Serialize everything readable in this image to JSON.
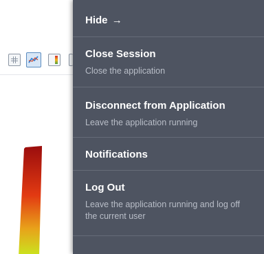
{
  "menu": {
    "hide": {
      "label": "Hide",
      "arrow": "→"
    },
    "items": [
      {
        "title": "Close Session",
        "description": "Close the application"
      },
      {
        "title": "Disconnect from Application",
        "description": "Leave the application running"
      },
      {
        "title": "Notifications",
        "description": ""
      },
      {
        "title": "Log Out",
        "description": "Leave the application running and log off the current user"
      }
    ]
  },
  "toolbar": {
    "icons": [
      "table-icon",
      "chart-icon",
      "colormap-icon"
    ]
  },
  "colors": {
    "menu_background": "#4e5461",
    "menu_divider": "#666c78",
    "menu_title": "#ffffff",
    "menu_description": "#b9bec8",
    "bar_top": "#9a0d0d",
    "bar_middle": "#e23a12",
    "bar_bottom": "#c9e61f"
  }
}
